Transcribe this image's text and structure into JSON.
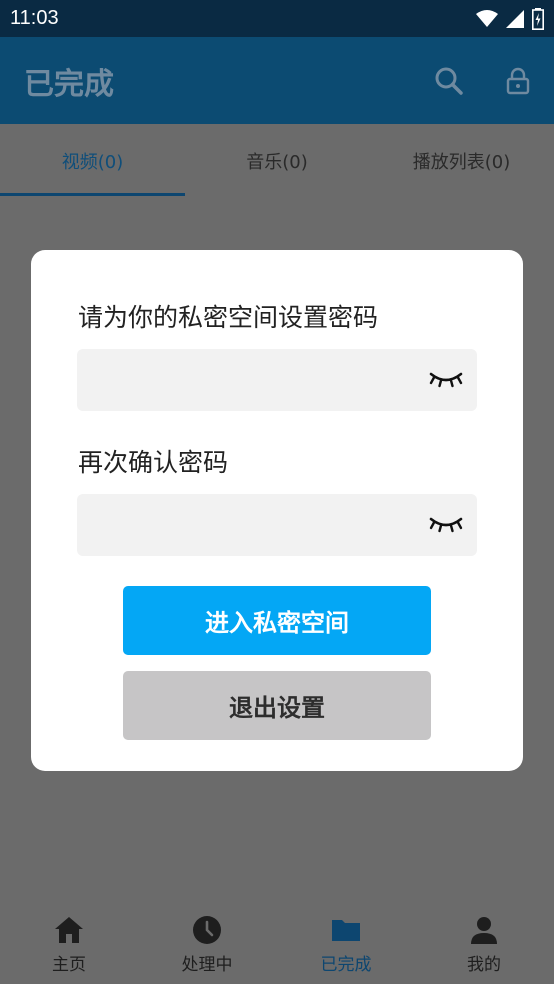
{
  "status_bar": {
    "time": "11:03"
  },
  "app_bar": {
    "title": "已完成",
    "icons": [
      "search-icon",
      "lock-icon"
    ]
  },
  "tabs": [
    {
      "label": "视频(0)",
      "active": true
    },
    {
      "label": "音乐(0)",
      "active": false
    },
    {
      "label": "播放列表(0)",
      "active": false
    }
  ],
  "dialog": {
    "password_label": "请为你的私密空间设置密码",
    "password_value": "",
    "confirm_label": "再次确认密码",
    "confirm_value": "",
    "enter_button": "进入私密空间",
    "exit_button": "退出设置"
  },
  "bottom_nav": [
    {
      "label": "主页",
      "icon": "home-icon",
      "active": false
    },
    {
      "label": "处理中",
      "icon": "clock-icon",
      "active": false
    },
    {
      "label": "已完成",
      "icon": "folder-icon",
      "active": true
    },
    {
      "label": "我的",
      "icon": "person-icon",
      "active": false
    }
  ],
  "colors": {
    "primary_button": "#04a7f5",
    "secondary_button": "#c6c5c6",
    "app_bar": "#0c4b72",
    "accent_active": "#0d4670"
  }
}
